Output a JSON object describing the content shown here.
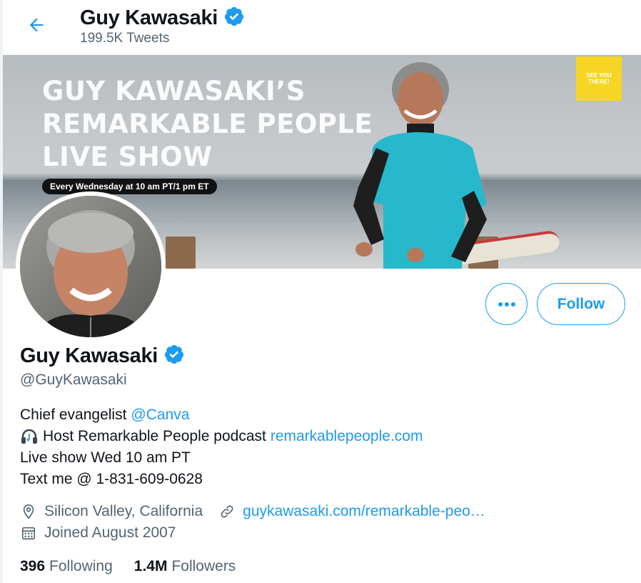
{
  "header": {
    "back_icon": "arrow-left-icon",
    "name": "Guy Kawasaki",
    "verified_icon": "verified-badge-icon",
    "tweet_count": "199.5K Tweets"
  },
  "banner": {
    "title_lines": [
      "GUY KAWASAKI’S",
      "REMARKABLE PEOPLE",
      "LIVE SHOW"
    ],
    "schedule_pill": "Every Wednesday at 10 am PT/1 pm ET",
    "sticker_lines": [
      "SEE YOU",
      "THERE!"
    ],
    "sticker_color": "#f7d524"
  },
  "actions": {
    "more_icon": "more-horizontal-icon",
    "follow_label": "Follow"
  },
  "profile": {
    "name": "Guy Kawasaki",
    "handle": "@GuyKawasaki",
    "bio": {
      "line1_text": "Chief evangelist",
      "line1_link": "@Canva",
      "line2_icon": "headphones-emoji",
      "line2_text": "Host Remarkable People podcast",
      "line2_link": "remarkablepeople.com",
      "line3_text": "Live show Wed 10 am PT",
      "line4_text": "Text me @ 1-831-609-0628"
    },
    "location_icon": "location-pin-icon",
    "location": "Silicon Valley, California",
    "website_icon": "link-icon",
    "website": "guykawasaki.com/remarkable-peo…",
    "joined_icon": "calendar-icon",
    "joined": "Joined August 2007"
  },
  "stats": {
    "following_count": "396",
    "following_label": "Following",
    "followers_count": "1.4M",
    "followers_label": "Followers"
  },
  "colors": {
    "accent": "#1d9bf0",
    "secondary_text": "#536471",
    "primary_text": "#0f1419"
  }
}
